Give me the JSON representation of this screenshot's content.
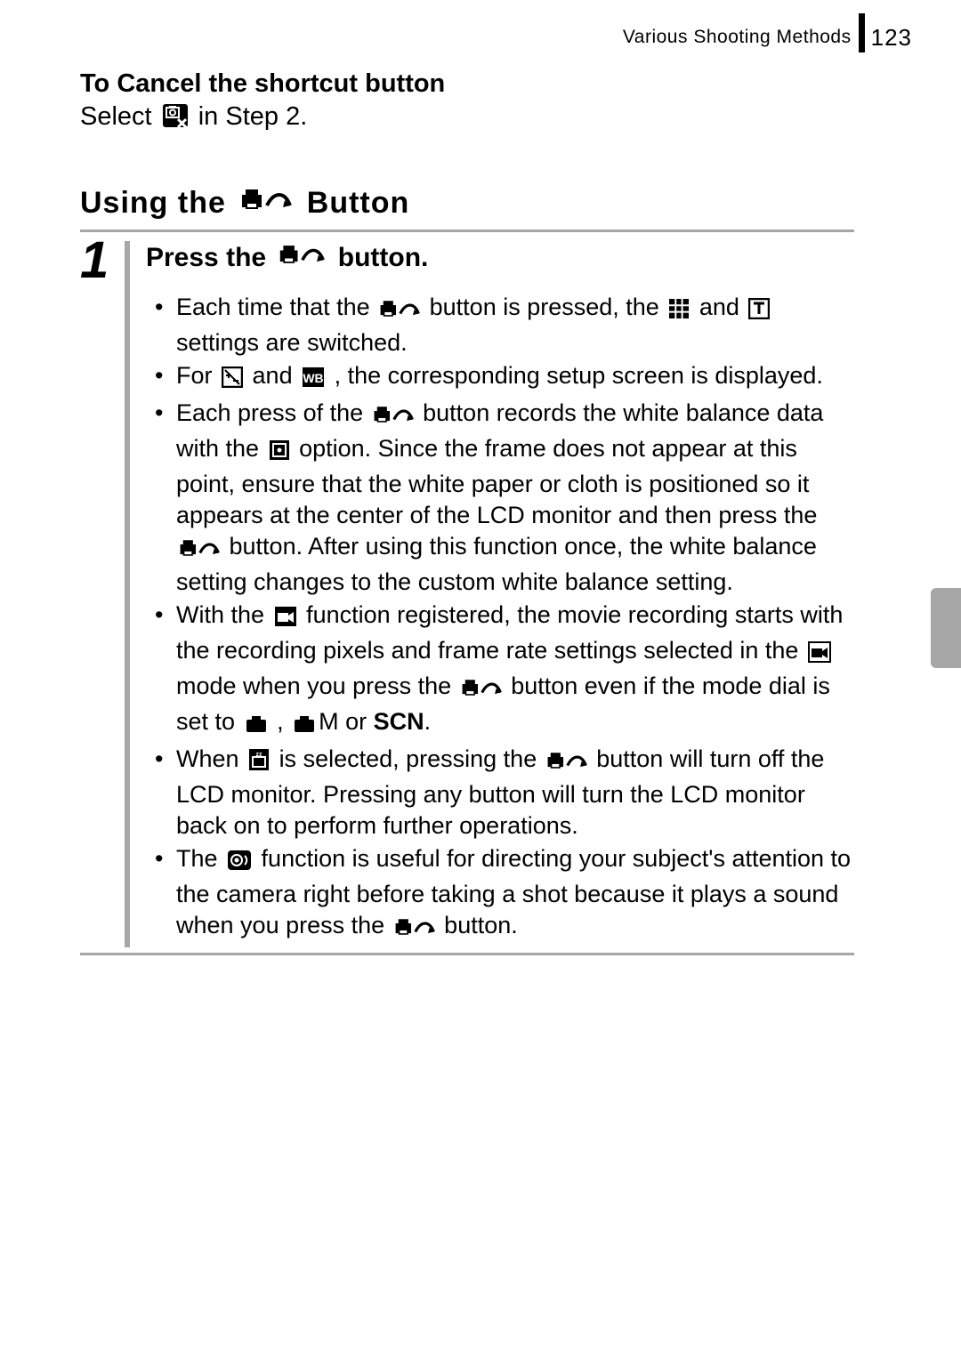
{
  "header": {
    "section": "Various Shooting Methods",
    "page": "123"
  },
  "cancel": {
    "heading": "To Cancel the shortcut button",
    "prefix": "Select ",
    "suffix": " in Step 2."
  },
  "title": {
    "pre": "Using the ",
    "post": " Button"
  },
  "step": {
    "num": "1",
    "pre": "Press the ",
    "post": " button."
  },
  "bullets": {
    "b1a": "Each time that the ",
    "b1b": " button is pressed, the ",
    "b1c": " and ",
    "b1d": " settings are switched.",
    "b2a": "For ",
    "b2b": " and ",
    "b2c": ", the corresponding setup screen is displayed.",
    "b3a": "Each press of the ",
    "b3b": " button records the white balance data with the ",
    "b3c": " option. Since the frame does not appear at this point, ensure that the white paper or cloth is positioned so it appears at the center of the LCD monitor and then press the ",
    "b3d": " button. After using this function once, the white balance setting changes to the custom white balance setting.",
    "b4a": "With the ",
    "b4b": " function registered, the movie recording starts with the recording pixels and frame rate settings selected in the ",
    "b4c": " mode when you press the ",
    "b4d": " button even if the mode dial is set to ",
    "b4e": ", ",
    "b4f": "M or ",
    "b4g": "SCN",
    "b4h": ".",
    "b5a": "When ",
    "b5b": " is selected, pressing the ",
    "b5c": " button will turn off the LCD monitor. Pressing any button will turn the LCD monitor back on to perform further operations.",
    "b6a": "The ",
    "b6b": " function is useful for directing your subject's attention to the camera right before taking a shot because it plays a sound when you press the ",
    "b6c": " button."
  }
}
